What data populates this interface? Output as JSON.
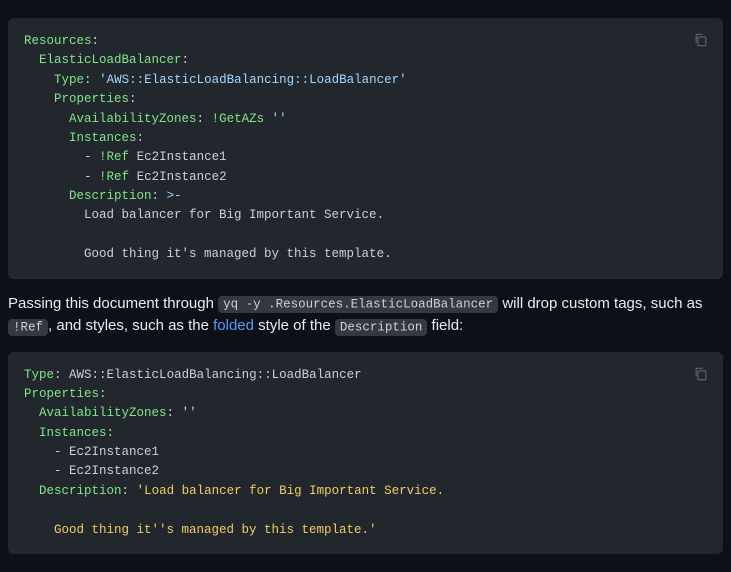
{
  "code1": {
    "l1_k": "Resources",
    "l2_k": "ElasticLoadBalancer",
    "l3_k": "Type",
    "l3_v": "'AWS::ElasticLoadBalancing::LoadBalancer'",
    "l4_k": "Properties",
    "l5_k": "AvailabilityZones",
    "l5_tag": "!GetAZs",
    "l5_v": "''",
    "l6_k": "Instances",
    "l7_tag": "!Ref",
    "l7_v": "Ec2Instance1",
    "l8_tag": "!Ref",
    "l8_v": "Ec2Instance2",
    "l9_k": "Description",
    "l9_fold": ">-",
    "l10": "Load balancer for Big Important Service.",
    "l11": "Good thing it's managed by this template."
  },
  "para1": {
    "t1": "Passing this document through ",
    "cmd": "yq -y .Resources.ElasticLoadBalancer",
    "t2": " will drop custom tags, such as ",
    "ref": "!Ref",
    "t3": ", and styles, such as the ",
    "link_text": "folded",
    "t4": " style of the ",
    "desc": "Description",
    "t5": " field:"
  },
  "code2": {
    "l1_k": "Type",
    "l1_v": "AWS::ElasticLoadBalancing::LoadBalancer",
    "l2_k": "Properties",
    "l3_k": "AvailabilityZones",
    "l3_v": "''",
    "l4_k": "Instances",
    "l5_v": "Ec2Instance1",
    "l6_v": "Ec2Instance2",
    "l7_k": "Description",
    "l7_q1": "'Load balancer for Big Important Service.",
    "l8": "    Good thing it''s managed by this template.'"
  }
}
